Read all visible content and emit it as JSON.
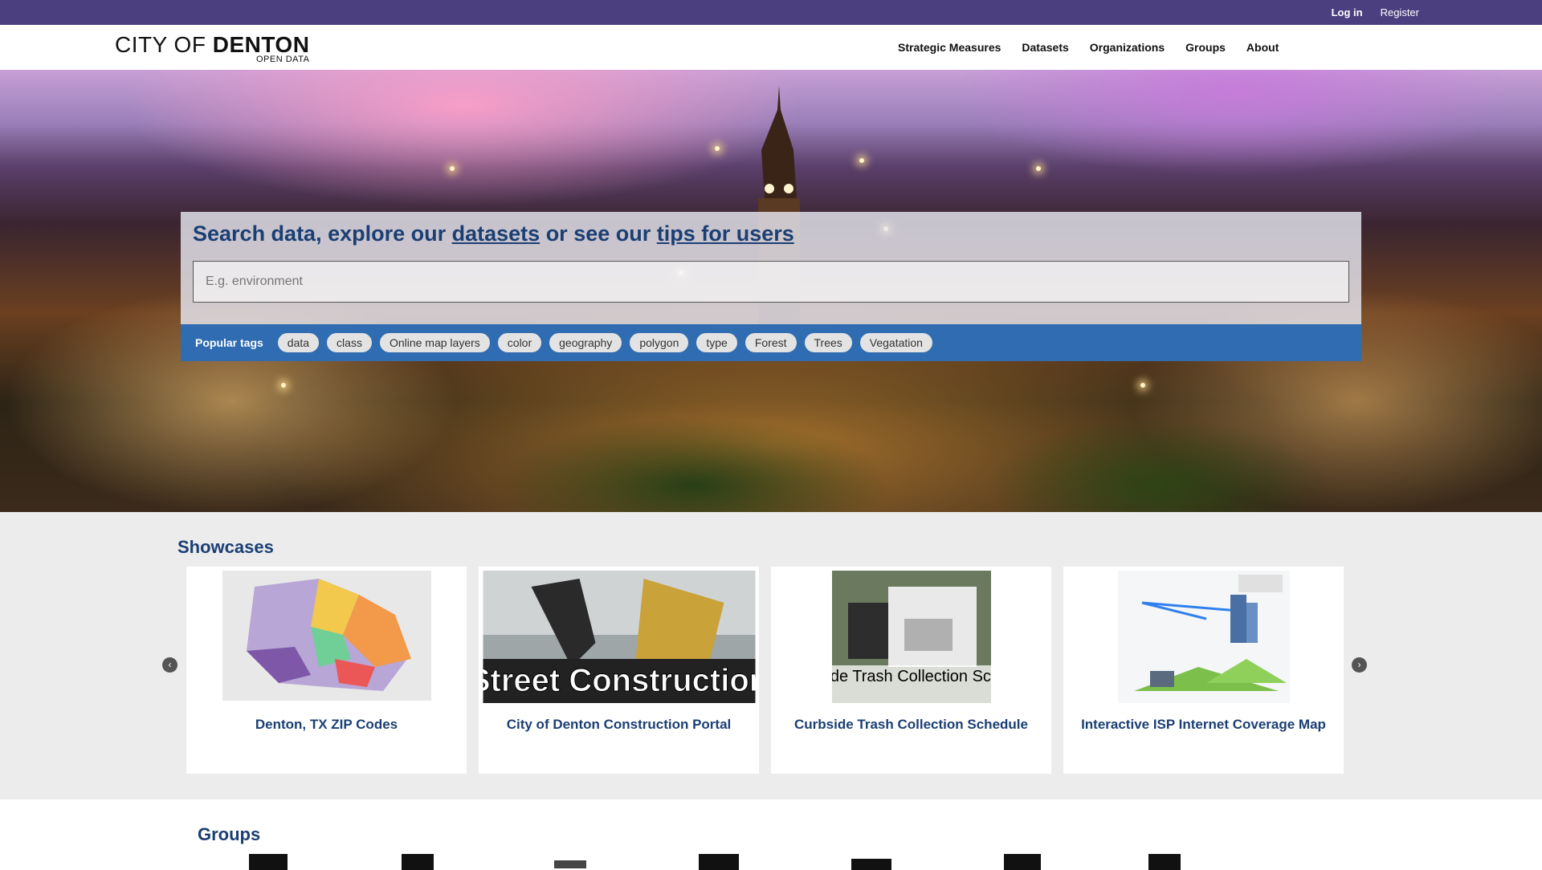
{
  "account": {
    "login": "Log in",
    "register": "Register"
  },
  "logo": {
    "main_light": "CITY OF ",
    "main_bold": "DENTON",
    "sub": "OPEN DATA"
  },
  "nav": [
    "Strategic Measures",
    "Datasets",
    "Organizations",
    "Groups",
    "About"
  ],
  "hero": {
    "title_pre": "Search data, explore our ",
    "title_link1": "datasets",
    "title_mid": " or see our ",
    "title_link2": "tips for users",
    "search_placeholder": "E.g. environment",
    "popular_tags_label": "Popular tags",
    "tags": [
      "data",
      "class",
      "Online map layers",
      "color",
      "geography",
      "polygon",
      "type",
      "Forest",
      "Trees",
      "Vegatation"
    ]
  },
  "showcases": {
    "title": "Showcases",
    "items": [
      {
        "caption": "Denton, TX ZIP Codes"
      },
      {
        "caption": "City of Denton Construction Portal",
        "image_text": "Street Construction"
      },
      {
        "caption": "Curbside Trash Collection Schedule",
        "image_text": "Curbside Trash Collection Schedule"
      },
      {
        "caption": "Interactive ISP Internet Coverage Map"
      }
    ],
    "prev": "‹",
    "next": "›"
  },
  "groups": {
    "title": "Groups"
  },
  "colors": {
    "top_bar": "#4b3f7f",
    "accent": "#1b3f73",
    "tags_bar": "#2f6cb1"
  }
}
